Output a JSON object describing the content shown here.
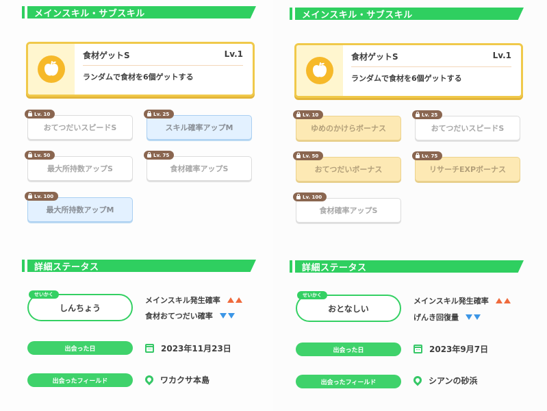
{
  "left": {
    "section_skills": "メインスキル・サブスキル",
    "main_skill": {
      "name": "食材ゲットS",
      "level": "Lv.1",
      "description": "ランダムで食材を6個ゲットする",
      "icon": "apple-icon"
    },
    "sub_skills": [
      {
        "level": "Lv. 10",
        "name": "おてつだいスピードS",
        "style": "white"
      },
      {
        "level": "Lv. 25",
        "name": "スキル確率アップM",
        "style": "blue"
      },
      {
        "level": "Lv. 50",
        "name": "最大所持数アップS",
        "style": "white"
      },
      {
        "level": "Lv. 75",
        "name": "食材確率アップS",
        "style": "white"
      },
      {
        "level": "Lv. 100",
        "name": "最大所持数アップM",
        "style": "blue"
      }
    ],
    "section_status": "詳細ステータス",
    "nature": {
      "tag": "せいかく",
      "value": "しんちょう"
    },
    "effects": [
      {
        "label": "メインスキル発生確率",
        "direction": "up"
      },
      {
        "label": "食材おてつだい確率",
        "direction": "down"
      }
    ],
    "met_date": {
      "label": "出会った日",
      "value": "2023年11月23日"
    },
    "met_field": {
      "label": "出会ったフィールド",
      "value": "ワカクサ本島"
    }
  },
  "right": {
    "section_skills": "メインスキル・サブスキル",
    "main_skill": {
      "name": "食材ゲットS",
      "level": "Lv.1",
      "description": "ランダムで食材を6個ゲットする",
      "icon": "apple-icon"
    },
    "sub_skills": [
      {
        "level": "Lv. 10",
        "name": "ゆめのかけらボーナス",
        "style": "gold"
      },
      {
        "level": "Lv. 25",
        "name": "おてつだいスピードS",
        "style": "white"
      },
      {
        "level": "Lv. 50",
        "name": "おてつだいボーナス",
        "style": "gold"
      },
      {
        "level": "Lv. 75",
        "name": "リサーチEXPボーナス",
        "style": "gold"
      },
      {
        "level": "Lv. 100",
        "name": "食材確率アップS",
        "style": "white"
      }
    ],
    "section_status": "詳細ステータス",
    "nature": {
      "tag": "せいかく",
      "value": "おとなしい"
    },
    "effects": [
      {
        "label": "メインスキル発生確率",
        "direction": "up"
      },
      {
        "label": "げんき回復量",
        "direction": "down"
      }
    ],
    "met_date": {
      "label": "出会った日",
      "value": "2023年9月7日"
    },
    "met_field": {
      "label": "出会ったフィールド",
      "value": "シアンの砂浜"
    }
  },
  "colors": {
    "green": "#2fcf60",
    "gold_border": "#f0c94a",
    "blue_skill": "#e3f1ff",
    "gold_skill": "#fde9b4",
    "up_arrow": "#ef6a3c",
    "down_arrow": "#3c96e6",
    "badge": "#8a6650"
  }
}
